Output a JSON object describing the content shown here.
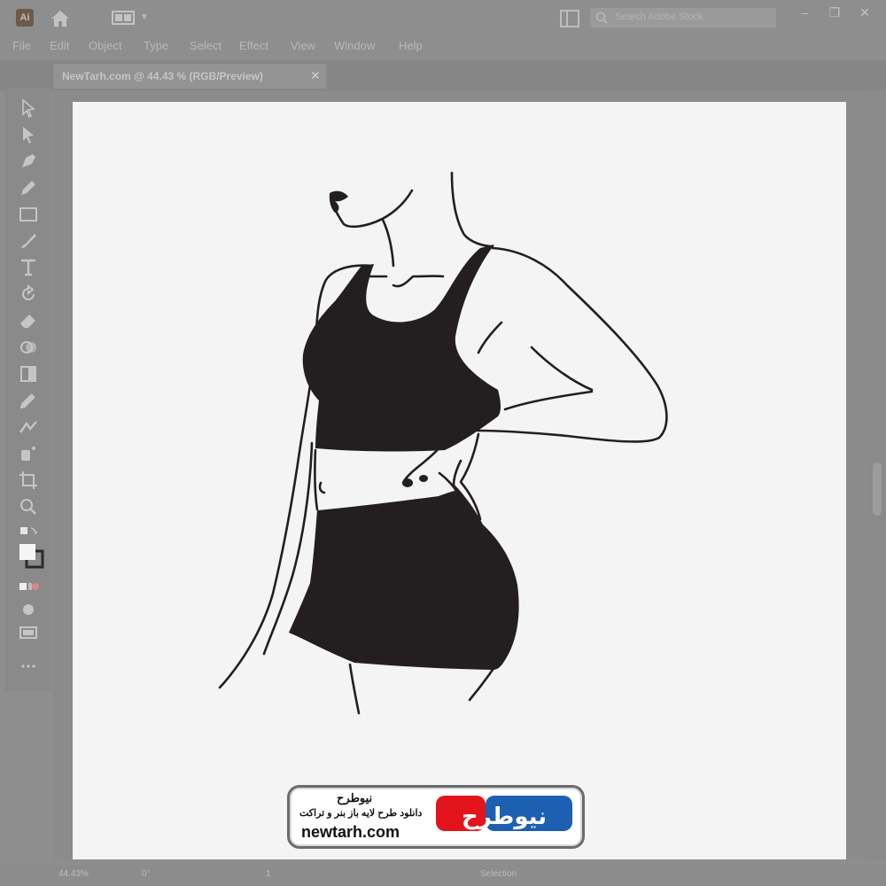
{
  "app": {
    "logo": "Ai",
    "search_placeholder": "Search Adobe Stock",
    "window_buttons": [
      "–",
      "❐",
      "✕"
    ]
  },
  "menu": [
    "File",
    "Edit",
    "Object",
    "Type",
    "Select",
    "Effect",
    "View",
    "Window",
    "Help"
  ],
  "document_tab": {
    "title": "NewTarh.com @ 44.43 % (RGB/Preview)",
    "close": "✕"
  },
  "tools": [
    "selection-tool-icon",
    "direct-selection-tool-icon",
    "pen-tool-icon",
    "pencil-tool-icon",
    "rectangle-tool-icon",
    "paintbrush-tool-icon",
    "type-tool-icon",
    "rotate-tool-icon",
    "eraser-tool-icon",
    "shape-builder-tool-icon",
    "gradient-tool-icon",
    "eyedropper-tool-icon",
    "blend-tool-icon",
    "symbol-sprayer-tool-icon",
    "artboard-tool-icon",
    "zoom-tool-icon"
  ],
  "status": {
    "zoom": "44.43%",
    "rotation": "0°",
    "artboard": "1",
    "mode": "Selection"
  },
  "watermark": {
    "line1": "نیوطرح",
    "line2": "دانلود طرح لایه باز بنر و تراکت",
    "url": "newtarh.com",
    "logo_text": "نیوطرح"
  },
  "colors": {
    "artboard": "#f4f4f4",
    "ink": "#231f20",
    "chrome": "#8e8e8e",
    "watermark_red": "#e3141b",
    "watermark_blue": "#1d5fb0"
  }
}
